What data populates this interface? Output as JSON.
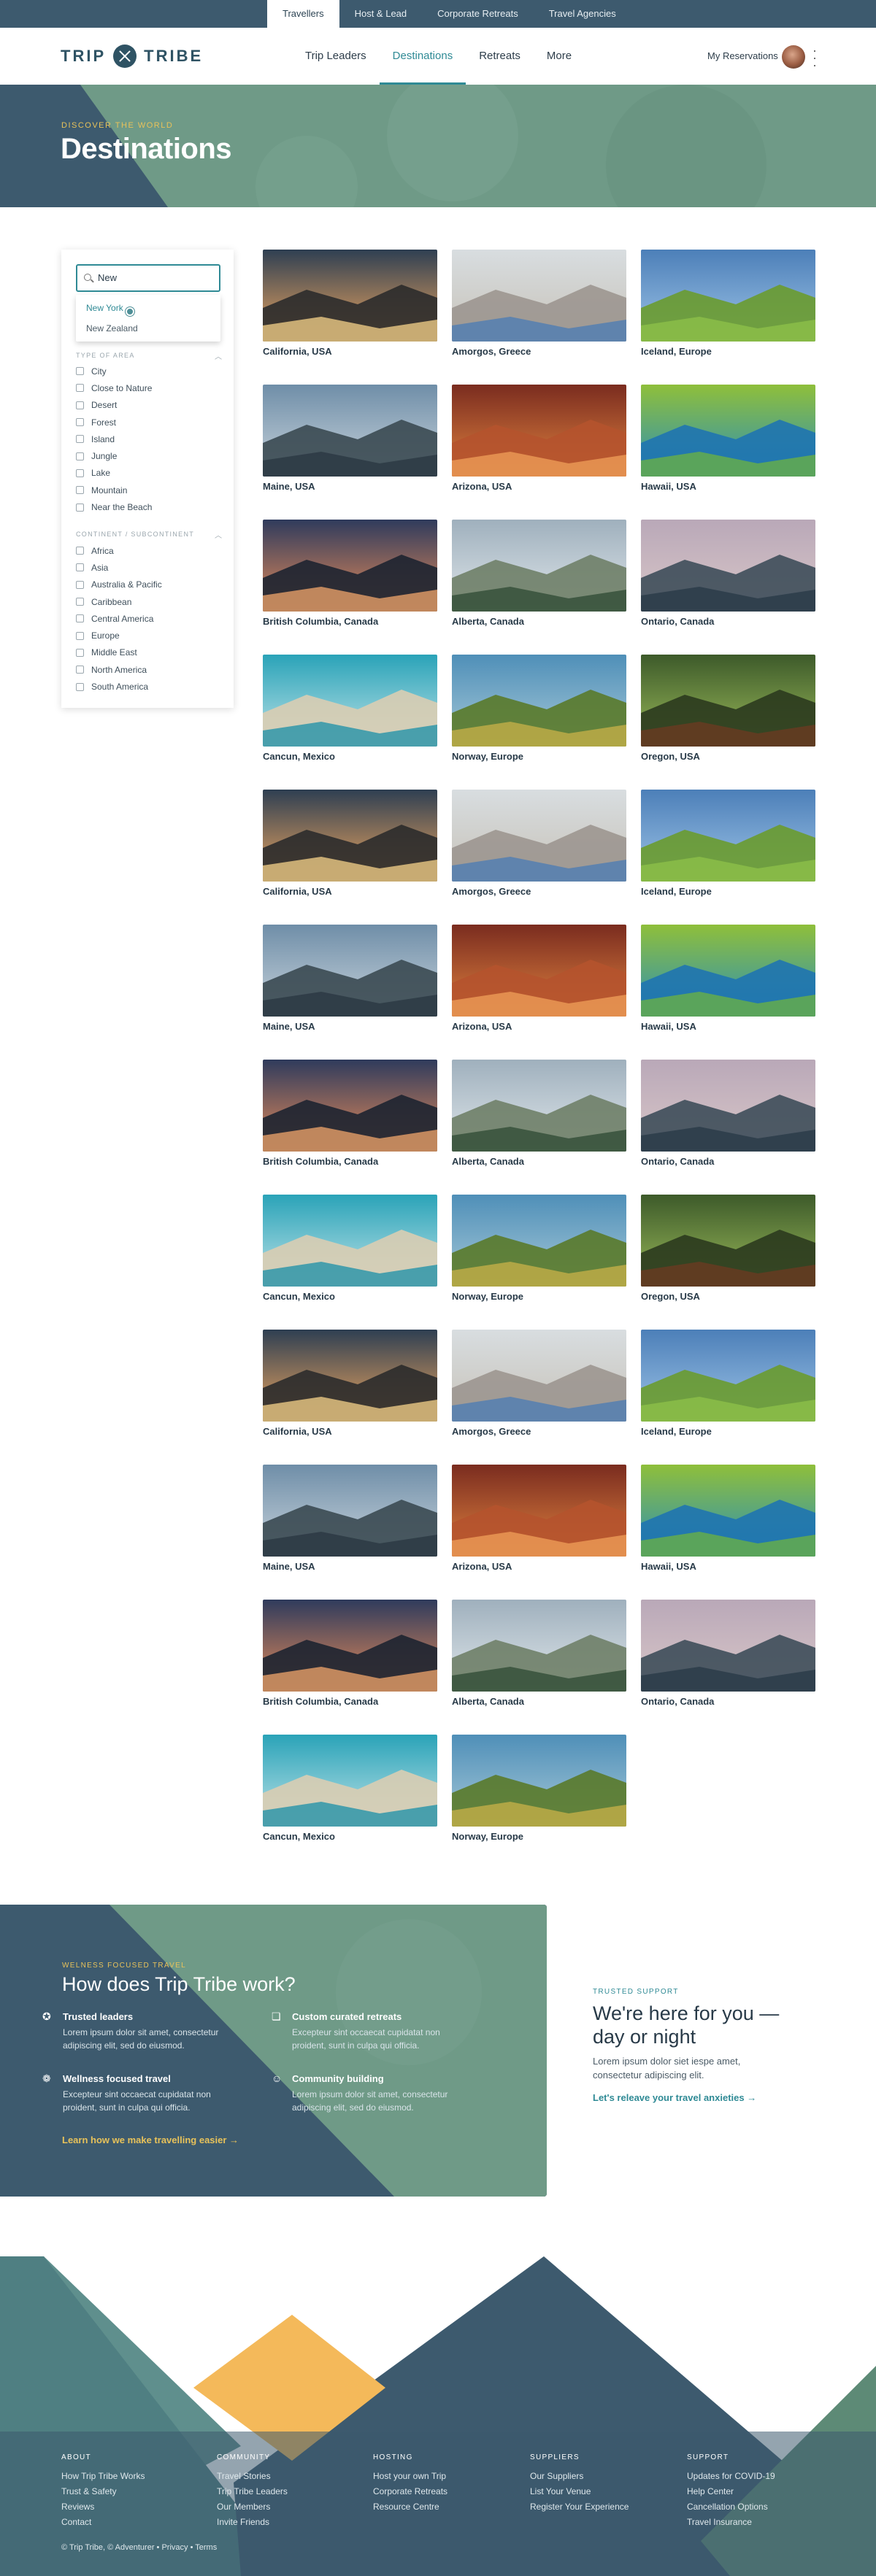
{
  "topbar": {
    "tabs": [
      "Travellers",
      "Host & Lead",
      "Corporate Retreats",
      "Travel Agencies"
    ],
    "active": "Travellers"
  },
  "nav": {
    "logo_left": "TRIP",
    "logo_right": "TRIBE",
    "logo_icon": "crossed-paddles-icon",
    "items": [
      "Trip Leaders",
      "Destinations",
      "Retreats",
      "More"
    ],
    "active": "Destinations",
    "reservations": "My Reservations"
  },
  "hero": {
    "kicker": "DISCOVER THE WORLD",
    "title": "Destinations"
  },
  "filters": {
    "search_value": "New",
    "suggestions": [
      "New York",
      "New Zealand"
    ],
    "area_title": "TYPE OF AREA",
    "areas": [
      "City",
      "Close to Nature",
      "Desert",
      "Forest",
      "Island",
      "Jungle",
      "Lake",
      "Mountain",
      "Near the Beach"
    ],
    "continent_title": "CONTINENT / SUBCONTINENT",
    "continents": [
      "Africa",
      "Asia",
      "Australia & Pacific",
      "Caribbean",
      "Central America",
      "Europe",
      "Middle East",
      "North America",
      "South America"
    ]
  },
  "destinations": [
    "California, USA",
    "Amorgos, Greece",
    "Iceland, Europe",
    "Maine, USA",
    "Arizona, USA",
    "Hawaii, USA",
    "British Columbia, Canada",
    "Alberta, Canada",
    "Ontario, Canada",
    "Cancun, Mexico",
    "Norway, Europe",
    "Oregon, USA",
    "California, USA",
    "Amorgos, Greece",
    "Iceland, Europe",
    "Maine, USA",
    "Arizona, USA",
    "Hawaii, USA",
    "British Columbia, Canada",
    "Alberta, Canada",
    "Ontario, Canada",
    "Cancun, Mexico",
    "Norway, Europe",
    "Oregon, USA",
    "California, USA",
    "Amorgos, Greece",
    "Iceland, Europe",
    "Maine, USA",
    "Arizona, USA",
    "Hawaii, USA",
    "British Columbia, Canada",
    "Alberta, Canada",
    "Ontario, Canada",
    "Cancun, Mexico",
    "Norway, Europe"
  ],
  "how": {
    "kicker": "WELNESS FOCUSED TRAVEL",
    "title": "How does Trip Tribe work?",
    "features": [
      {
        "icon": "award-icon",
        "title": "Trusted leaders",
        "desc": "Lorem ipsum dolor sit amet, consectetur adipiscing elit, sed do eiusmod."
      },
      {
        "icon": "curated-icon",
        "title": "Custom curated retreats",
        "desc": "Excepteur sint occaecat cupidatat non proident, sunt in culpa qui officia."
      },
      {
        "icon": "wellness-icon",
        "title": "Wellness focused travel",
        "desc": "Excepteur sint occaecat cupidatat non proident, sunt in culpa qui officia."
      },
      {
        "icon": "community-icon",
        "title": "Community building",
        "desc": "Lorem ipsum dolor sit amet, consectetur adipiscing elit, sed do eiusmod."
      }
    ],
    "link": "Learn how we make travelling easier →"
  },
  "support": {
    "kicker": "TRUSTED SUPPORT",
    "title": "We're here for you —day or night",
    "text": "Lorem ipsum dolor siet iespe amet, consectetur adipiscing elit.",
    "link": "Let's releave your travel anxieties →"
  },
  "footer": {
    "columns": [
      {
        "title": "ABOUT",
        "links": [
          "How Trip Tribe Works",
          "Trust & Safety",
          "Reviews",
          "Contact"
        ]
      },
      {
        "title": "COMMUNITY",
        "links": [
          "Travel Stories",
          "Trip Tribe Leaders",
          "Our Members",
          "Invite Friends"
        ]
      },
      {
        "title": "HOSTING",
        "links": [
          "Host your own Trip",
          "Corporate Retreats",
          "Resource Centre"
        ]
      },
      {
        "title": "SUPPLIERS",
        "links": [
          "Our Suppliers",
          "List Your Venue",
          "Register Your Experience"
        ]
      },
      {
        "title": "SUPPORT",
        "links": [
          "Updates for COVID-19",
          "Help Center",
          "Cancellation Options",
          "Travel Insurance"
        ]
      }
    ],
    "copyright": "© Trip Tribe, © Adventurer  •  Privacy  •  Terms"
  },
  "colors": {
    "accent": "#2f8a95",
    "brand_dark": "#3d5a6e",
    "gold": "#e8c25a",
    "sage": "#6f9a87"
  }
}
